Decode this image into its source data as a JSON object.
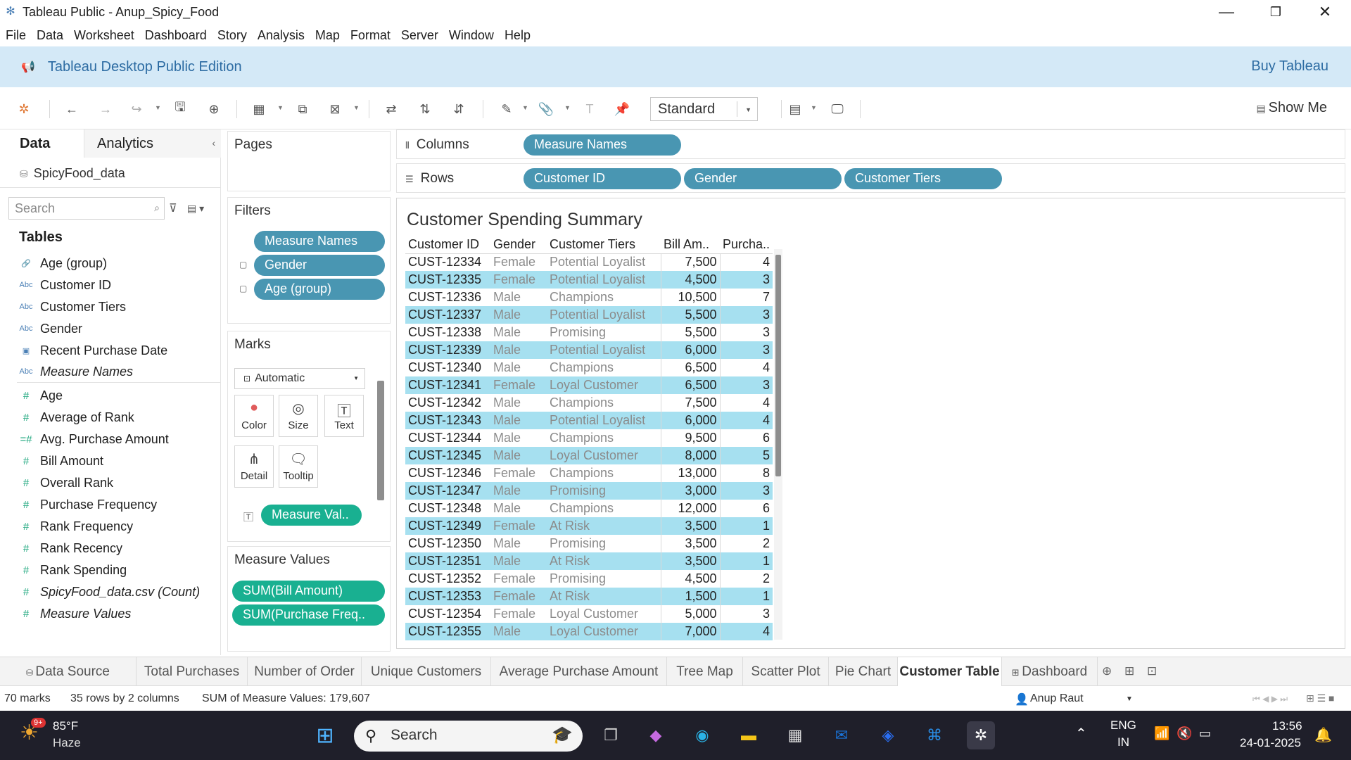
{
  "window": {
    "title": "Tableau Public - Anup_Spicy_Food",
    "minimize": "—",
    "restore": "❐",
    "close": "✕"
  },
  "menu": [
    "File",
    "Data",
    "Worksheet",
    "Dashboard",
    "Story",
    "Analysis",
    "Map",
    "Format",
    "Server",
    "Window",
    "Help"
  ],
  "banner": {
    "edition": "Tableau Desktop Public Edition",
    "buy": "Buy Tableau"
  },
  "toolbar": {
    "fit_select": "Standard",
    "show_me": "Show Me"
  },
  "data_pane": {
    "tab_data": "Data",
    "tab_analytics": "Analytics",
    "datasource": "SpicyFood_data",
    "search_placeholder": "Search",
    "tables_heading": "Tables",
    "dimensions": [
      {
        "icon": "calendar-link",
        "name": "Age (group)",
        "italic": false
      },
      {
        "icon": "Abc",
        "name": "Customer ID",
        "italic": false
      },
      {
        "icon": "Abc",
        "name": "Customer Tiers",
        "italic": false
      },
      {
        "icon": "Abc",
        "name": "Gender",
        "italic": false
      },
      {
        "icon": "calendar",
        "name": "Recent Purchase Date",
        "italic": false
      },
      {
        "icon": "Abc",
        "name": "Measure Names",
        "italic": true
      }
    ],
    "measures": [
      {
        "name": "Age",
        "italic": false
      },
      {
        "name": "Average of Rank",
        "italic": false
      },
      {
        "name": "Avg. Purchase Amount",
        "italic": false
      },
      {
        "name": "Bill Amount",
        "italic": false
      },
      {
        "name": "Overall Rank",
        "italic": false
      },
      {
        "name": "Purchase Frequency",
        "italic": false
      },
      {
        "name": "Rank Frequency",
        "italic": false
      },
      {
        "name": "Rank Recency",
        "italic": false
      },
      {
        "name": "Rank Spending",
        "italic": false
      },
      {
        "name": "SpicyFood_data.csv (Count)",
        "italic": true
      },
      {
        "name": "Measure Values",
        "italic": true
      }
    ]
  },
  "pages": {
    "title": "Pages"
  },
  "filters": {
    "title": "Filters",
    "pills": [
      "Measure Names",
      "Gender",
      "Age (group)"
    ]
  },
  "marks": {
    "title": "Marks",
    "type": "Automatic",
    "buttons": [
      "Color",
      "Size",
      "Text",
      "Detail",
      "Tooltip"
    ],
    "text_pill": "Measure Val.."
  },
  "measure_values": {
    "title": "Measure Values",
    "pills": [
      "SUM(Bill Amount)",
      "SUM(Purchase Freq.."
    ]
  },
  "shelves": {
    "columns_label": "Columns",
    "columns": [
      "Measure Names"
    ],
    "rows_label": "Rows",
    "rows": [
      "Customer ID",
      "Gender",
      "Customer Tiers"
    ]
  },
  "viz": {
    "title": "Customer Spending Summary",
    "headers": [
      "Customer ID",
      "Gender",
      "Customer Tiers",
      "Bill Am..",
      "Purcha.."
    ],
    "rows": [
      [
        "CUST-12334",
        "Female",
        "Potential Loyalist",
        "7,500",
        "4"
      ],
      [
        "CUST-12335",
        "Female",
        "Potential Loyalist",
        "4,500",
        "3"
      ],
      [
        "CUST-12336",
        "Male",
        "Champions",
        "10,500",
        "7"
      ],
      [
        "CUST-12337",
        "Male",
        "Potential Loyalist",
        "5,500",
        "3"
      ],
      [
        "CUST-12338",
        "Male",
        "Promising",
        "5,500",
        "3"
      ],
      [
        "CUST-12339",
        "Male",
        "Potential Loyalist",
        "6,000",
        "3"
      ],
      [
        "CUST-12340",
        "Male",
        "Champions",
        "6,500",
        "4"
      ],
      [
        "CUST-12341",
        "Female",
        "Loyal Customer",
        "6,500",
        "3"
      ],
      [
        "CUST-12342",
        "Male",
        "Champions",
        "7,500",
        "4"
      ],
      [
        "CUST-12343",
        "Male",
        "Potential Loyalist",
        "6,000",
        "4"
      ],
      [
        "CUST-12344",
        "Male",
        "Champions",
        "9,500",
        "6"
      ],
      [
        "CUST-12345",
        "Male",
        "Loyal Customer",
        "8,000",
        "5"
      ],
      [
        "CUST-12346",
        "Female",
        "Champions",
        "13,000",
        "8"
      ],
      [
        "CUST-12347",
        "Male",
        "Promising",
        "3,000",
        "3"
      ],
      [
        "CUST-12348",
        "Male",
        "Champions",
        "12,000",
        "6"
      ],
      [
        "CUST-12349",
        "Female",
        "At Risk",
        "3,500",
        "1"
      ],
      [
        "CUST-12350",
        "Male",
        "Promising",
        "3,500",
        "2"
      ],
      [
        "CUST-12351",
        "Male",
        "At Risk",
        "3,500",
        "1"
      ],
      [
        "CUST-12352",
        "Female",
        "Promising",
        "4,500",
        "2"
      ],
      [
        "CUST-12353",
        "Female",
        "At Risk",
        "1,500",
        "1"
      ],
      [
        "CUST-12354",
        "Female",
        "Loyal Customer",
        "5,000",
        "3"
      ],
      [
        "CUST-12355",
        "Male",
        "Loyal Customer",
        "7,000",
        "4"
      ]
    ],
    "highlighted_rows": [
      1,
      3,
      5,
      7,
      9,
      11,
      13,
      15,
      17,
      19,
      21
    ],
    "highlight_color": "#a6e0f0"
  },
  "sheet_tabs": [
    {
      "label": "Data Source",
      "active": false
    },
    {
      "label": "Total Purchases",
      "active": false
    },
    {
      "label": "Number of Order",
      "active": false
    },
    {
      "label": "Unique Customers",
      "active": false
    },
    {
      "label": "Average Purchase Amount",
      "active": false
    },
    {
      "label": "Tree Map",
      "active": false
    },
    {
      "label": "Scatter Plot",
      "active": false
    },
    {
      "label": "Pie Chart",
      "active": false
    },
    {
      "label": "Customer Table",
      "active": true
    },
    {
      "label": "Dashboard",
      "active": false
    }
  ],
  "status": {
    "marks": "70 marks",
    "dims": "35 rows by 2 columns",
    "sum": "SUM of Measure Values: 179,607",
    "user": "Anup Raut"
  },
  "taskbar": {
    "weather_temp": "85°F",
    "weather_desc": "Haze",
    "weather_badge": "9+",
    "search": "Search",
    "lang1": "ENG",
    "lang2": "IN",
    "time": "13:56",
    "date": "24-01-2025"
  },
  "colors": {
    "pill_blue": "#4996b2",
    "pill_green": "#19b091",
    "banner": "#d4e9f7",
    "taskbar": "#1f1f2a"
  }
}
